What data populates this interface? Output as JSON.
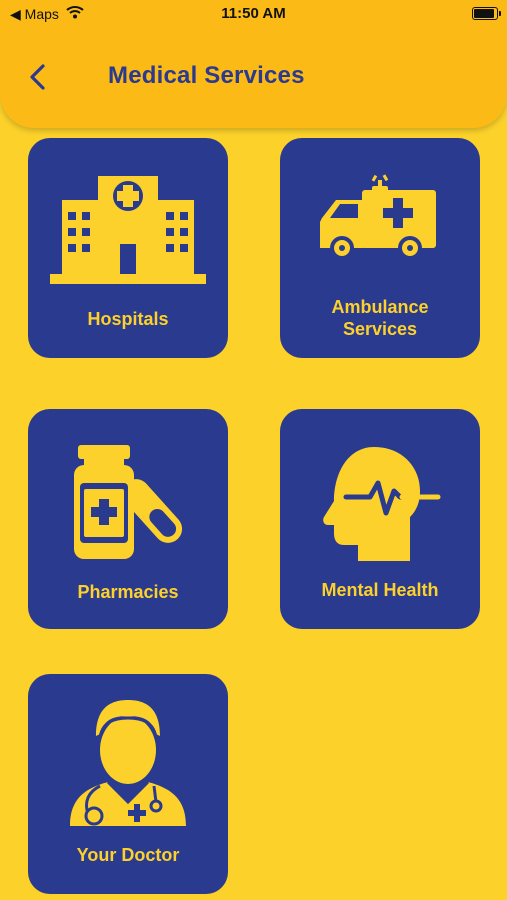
{
  "status_bar": {
    "back_app": "Maps",
    "time": "11:50 AM"
  },
  "header": {
    "title": "Medical Services"
  },
  "services": [
    {
      "label": "Hospitals",
      "icon": "hospital-icon"
    },
    {
      "label": "Ambulance Services",
      "icon": "ambulance-icon"
    },
    {
      "label": "Pharmacies",
      "icon": "pharmacy-icon"
    },
    {
      "label": "Mental Health",
      "icon": "mental-health-icon"
    },
    {
      "label": "Your Doctor",
      "icon": "doctor-icon"
    }
  ],
  "colors": {
    "background": "#FCD22A",
    "header": "#FBBA16",
    "tile": "#2A3A8E",
    "accent": "#FDD12B"
  }
}
